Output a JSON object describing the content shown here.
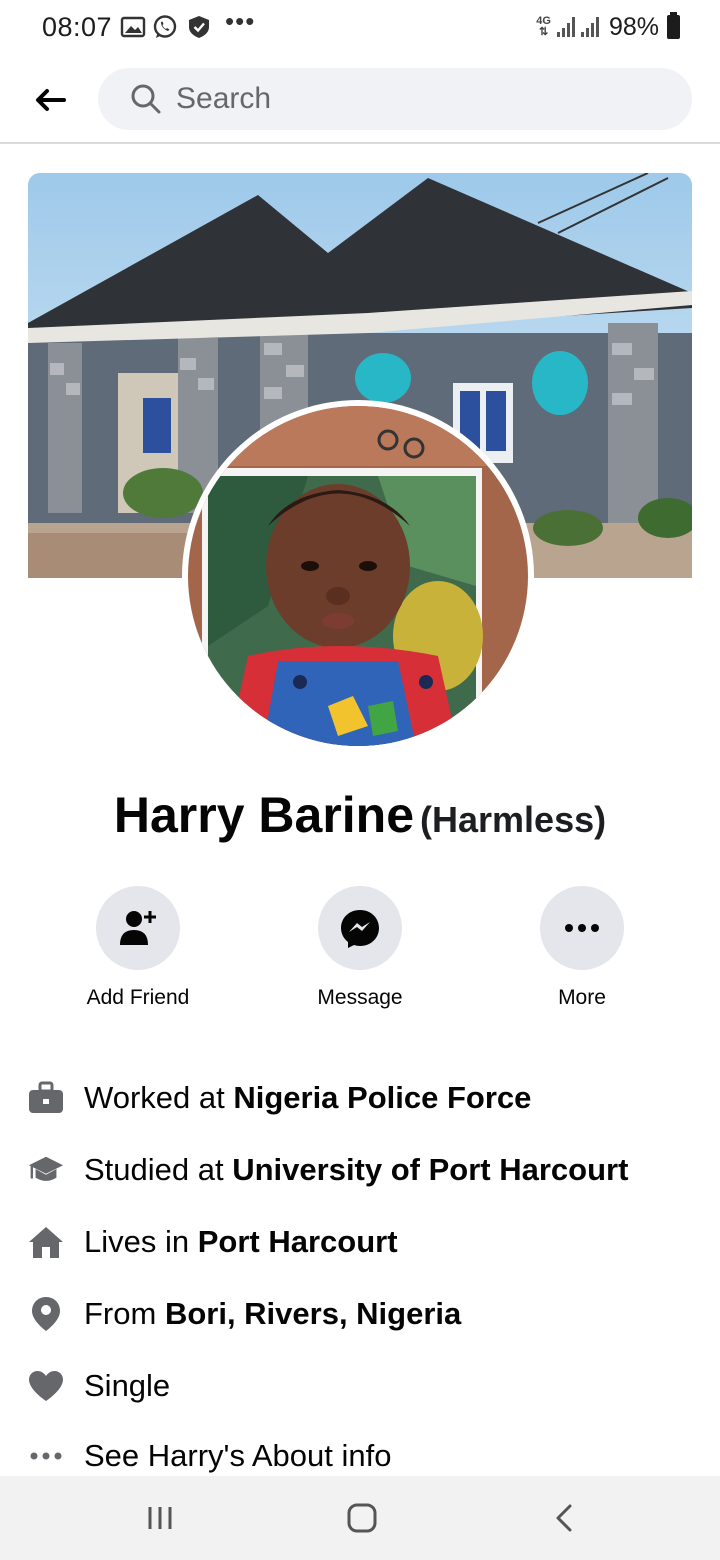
{
  "status_bar": {
    "time": "08:07",
    "network": "4G",
    "battery": "98%",
    "more": "•••"
  },
  "header": {
    "search_placeholder": "Search"
  },
  "profile": {
    "name": "Harry Barine",
    "nickname": "(Harmless)"
  },
  "actions": [
    {
      "label": "Add Friend",
      "icon": "add-friend-icon"
    },
    {
      "label": "Message",
      "icon": "messenger-icon"
    },
    {
      "label": "More",
      "icon": "more-icon"
    }
  ],
  "details": [
    {
      "icon": "briefcase-icon",
      "prefix": "Worked at ",
      "value": "Nigeria Police Force"
    },
    {
      "icon": "graduation-cap-icon",
      "prefix": "Studied at ",
      "value": "University of Port Harcourt"
    },
    {
      "icon": "home-icon",
      "prefix": "Lives in ",
      "value": "Port Harcourt"
    },
    {
      "icon": "location-pin-icon",
      "prefix": "From ",
      "value": "Bori, Rivers, Nigeria"
    },
    {
      "icon": "heart-icon",
      "prefix": "Single",
      "value": ""
    },
    {
      "icon": "more-dots-icon",
      "prefix": "See Harry's About info",
      "value": ""
    }
  ],
  "colors": {
    "action_bg": "#e4e6eb",
    "search_bg": "#f0f2f5",
    "icon_gray": "#65676b",
    "text": "#050505"
  }
}
